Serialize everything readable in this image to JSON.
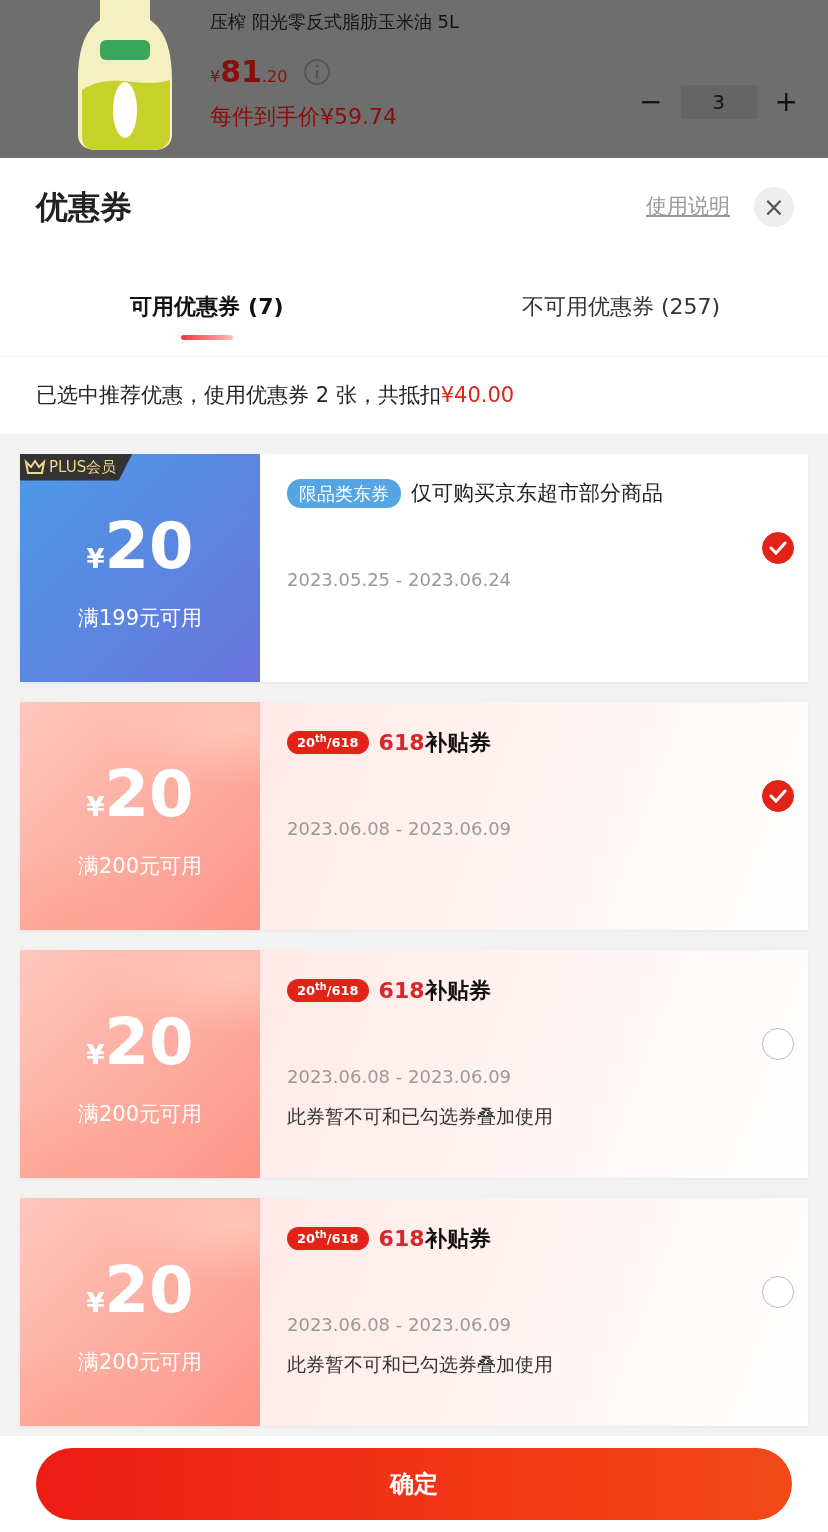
{
  "product": {
    "title": "压榨 阳光零反式脂肪玉米油 5L",
    "price": {
      "currency": "¥",
      "integer": "81",
      "decimal": ".20"
    },
    "unit_price": "每件到手价¥59.74",
    "quantity": "3",
    "minus": "−",
    "plus": "+"
  },
  "sheet": {
    "title": "优惠券",
    "help_link": "使用说明",
    "close": "×"
  },
  "tabs": [
    {
      "label": "可用优惠券 (7)",
      "selected": true
    },
    {
      "label": "不可用优惠券 (257)",
      "selected": false
    }
  ],
  "summary": {
    "text": "已选中推荐优惠，使用优惠券 2 张，共抵扣",
    "amount": "¥40.00"
  },
  "coupons": [
    {
      "kind": "plus",
      "badge": "PLUS会员",
      "currency": "¥",
      "amount": "20",
      "condition": "满199元可用",
      "tag": "限品类东券",
      "title": "仅可购买京东超市部分商品",
      "validity": "2023.05.25 - 2023.06.24",
      "checked": true
    },
    {
      "kind": "subsidy",
      "tag": "20$^{th}$/618",
      "title_highlight": "618",
      "title": "补贴券",
      "currency": "¥",
      "amount": "20",
      "condition": "满200元可用",
      "validity": "2023.06.08 - 2023.06.09",
      "checked": true
    },
    {
      "kind": "subsidy",
      "tag": "20$^{th}$/618",
      "title_highlight": "618",
      "title": "补贴券",
      "currency": "¥",
      "amount": "20",
      "condition": "满200元可用",
      "validity": "2023.06.08 - 2023.06.09",
      "note": "此券暂不可和已勾选券叠加使用",
      "checked": false
    },
    {
      "kind": "subsidy",
      "tag": "20$^{th}$/618",
      "title_highlight": "618",
      "title": "补贴券",
      "currency": "¥",
      "amount": "20",
      "condition": "满200元可用",
      "validity": "2023.06.08 - 2023.06.09",
      "note": "此券暂不可和已勾选券叠加使用",
      "checked": false
    }
  ],
  "confirm_button": "确定"
}
